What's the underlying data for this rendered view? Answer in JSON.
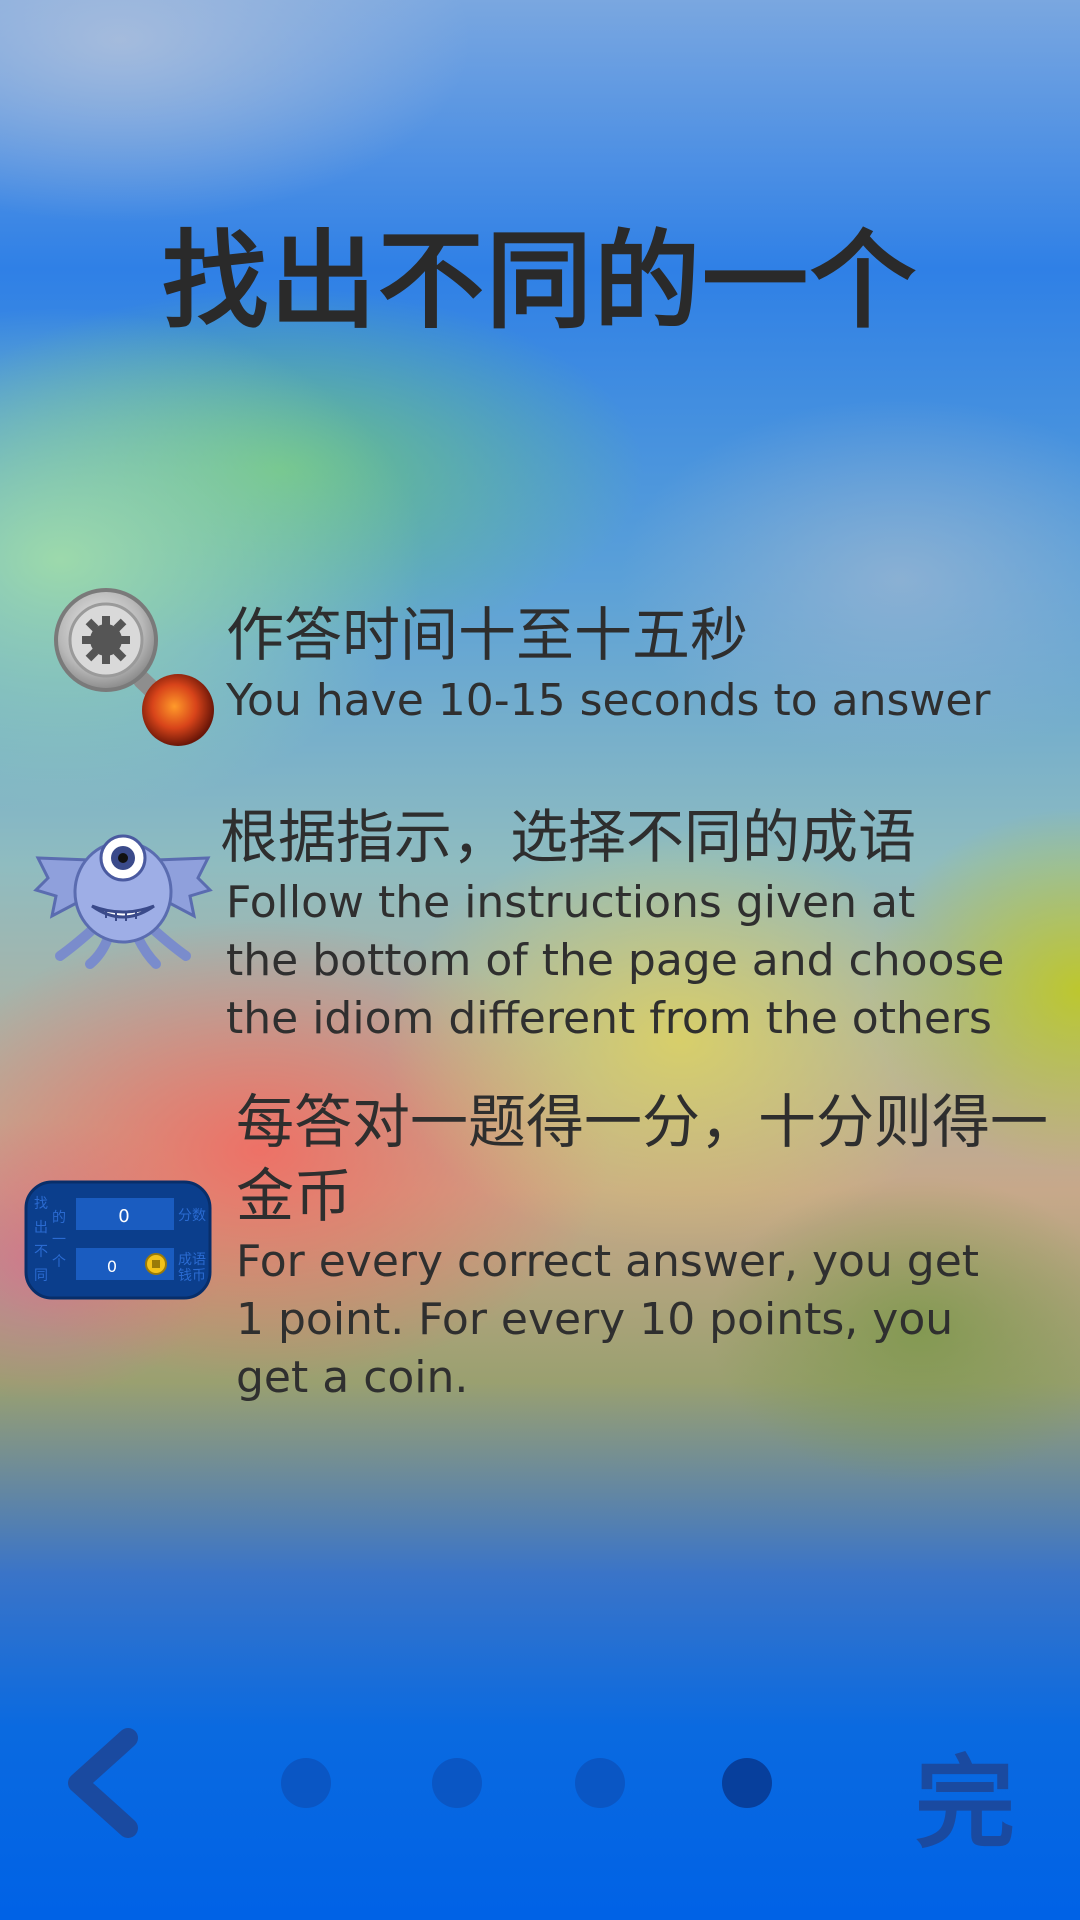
{
  "title": "找出不同的一个",
  "items": [
    {
      "zh": "作答时间十至十五秒",
      "en": "You have 10-15 seconds to answer",
      "icon": "magnifier-timer-icon"
    },
    {
      "zh": "根据指示，选择不同的成语",
      "en": "Follow the instructions given at\nthe bottom of the page and choose\nthe idiom different from the others",
      "icon": "cyclops-monster-icon"
    },
    {
      "zh": "每答对一题得一分，十分则得一金币",
      "en": "For every correct answer, you get\n1 point. For every 10 points, you\nget a coin.",
      "icon": "game-board-icon"
    }
  ],
  "board_icon": {
    "left_chars": [
      "找",
      "的",
      "出",
      "一",
      "不",
      "个",
      "同"
    ],
    "right_top": "分数",
    "right_bottom": "成语",
    "right_bottom2": "钱币",
    "cell_digit": "0"
  },
  "nav": {
    "back_icon": "chevron-left-icon",
    "page_count": 4,
    "active_page": 4,
    "finish_label": "完"
  },
  "colors": {
    "text": "#2e2e2e",
    "dot": "#0a56c4",
    "dot_active": "#073f9c",
    "finish": "#1a4aa0"
  }
}
